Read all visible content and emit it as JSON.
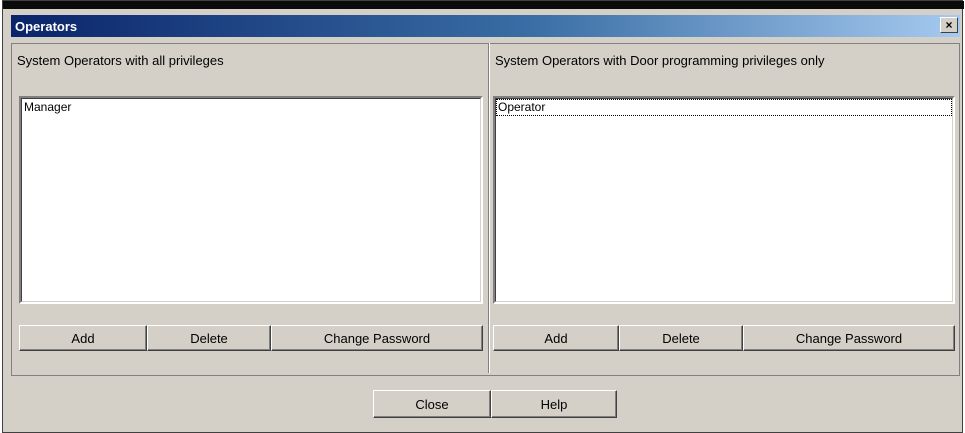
{
  "window": {
    "title": "Operators",
    "close_glyph": "×"
  },
  "left_panel": {
    "header": "System Operators with all privileges",
    "items": [
      "Manager"
    ],
    "buttons": {
      "add": "Add",
      "delete": "Delete",
      "change_password": "Change Password"
    }
  },
  "right_panel": {
    "header": "System Operators with Door programming privileges only",
    "items": [
      "Operator"
    ],
    "buttons": {
      "add": "Add",
      "delete": "Delete",
      "change_password": "Change Password"
    }
  },
  "footer": {
    "close": "Close",
    "help": "Help"
  },
  "colors": {
    "title_start": "#0a246a",
    "title_end": "#a6caf0",
    "face": "#d4d0c8"
  }
}
